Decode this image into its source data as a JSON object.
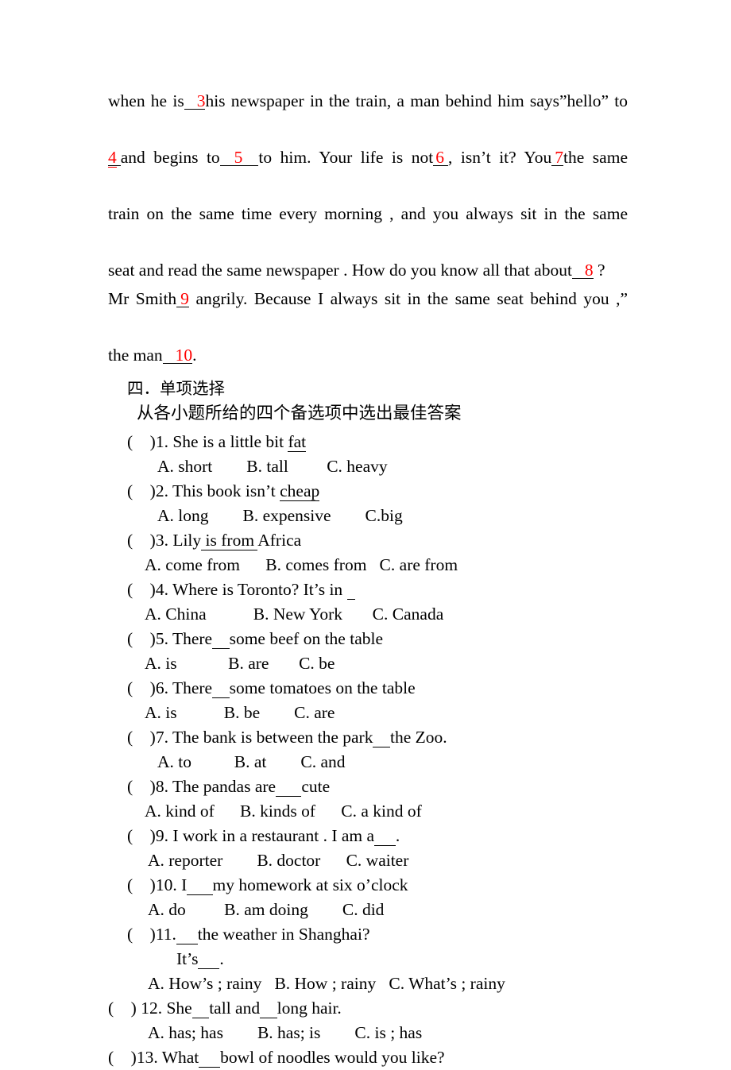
{
  "document": {
    "cloze_paragraph": {
      "line1_a": "when he is",
      "blank3": "3",
      "line1_b": "his newspaper in the train, a man behind him says”hello” to",
      "blank4": "4",
      "line2_a": "and begins to",
      "blank5": "5",
      "line2_b": "to him. Your life is not",
      "blank6": "6",
      "line2_c": ", isn’t it? You",
      "blank7": "7",
      "line2_d": "the same",
      "line3": "train on the same time every morning , and you always sit in the same",
      "line4_a": "seat and read the same newspaper . How do you know all that about",
      "blank8": "8",
      "line4_b": "?",
      "line5_a": "Mr Smith",
      "blank9": "9",
      "line5_b": "angrily. Because I always sit in the same seat behind you ,”",
      "line6_a": "the man",
      "blank10": "10",
      "line6_b": "."
    },
    "section_heading": "四．单项选择",
    "section_instruction": "从各小题所给的四个备选项中选出最佳答案",
    "questions": [
      {
        "marker": "(    )",
        "number": "1.",
        "stem_before": " She is a little bit ",
        "stem_underline": "fat",
        "stem_after": "",
        "options": "A. short        B. tall         C. heavy"
      },
      {
        "marker": "(    )",
        "number": "2.",
        "stem_before": " This book isn’t ",
        "stem_underline": "cheap",
        "stem_after": "",
        "options": "A. long        B. expensive        C.big"
      },
      {
        "marker": "(    )",
        "number": "3.",
        "stem_before": " Lily",
        "stem_underline": " is from ",
        "stem_after": "Africa",
        "options": "A. come from      B. comes from   C. are from"
      },
      {
        "marker": "(    )",
        "number": "4.",
        "stem_before": " Where is Toronto? It’s in ",
        "stem_underline": "  ",
        "stem_after": "",
        "options": "A. China           B. New York       C. Canada"
      },
      {
        "marker": "(    )",
        "number": "5.",
        "stem_before": " There",
        "stem_underline": "    ",
        "stem_after": "some beef on the table",
        "options": "A. is            B. are       C. be"
      },
      {
        "marker": "(    )",
        "number": "6.",
        "stem_before": " There",
        "stem_underline": "    ",
        "stem_after": "some tomatoes on the table",
        "options": "A. is           B. be        C. are"
      },
      {
        "marker": "(    )",
        "number": "7.",
        "stem_before": " The bank is between the park",
        "stem_underline": "    ",
        "stem_after": "the Zoo.",
        "options": "A. to          B. at        C. and"
      },
      {
        "marker": "(    )",
        "number": "8.",
        "stem_before": " The pandas are",
        "stem_underline": "      ",
        "stem_after": "cute",
        "options": "A. kind of      B. kinds of      C. a kind of"
      },
      {
        "marker": "(    )",
        "number": "9.",
        "stem_before": " I work in a restaurant . I am a",
        "stem_underline": "     ",
        "stem_after": ".",
        "options": "A. reporter        B. doctor      C. waiter"
      },
      {
        "marker": "(    )",
        "number": "10.",
        "stem_before": " I",
        "stem_underline": "      ",
        "stem_after": "my homework at six o’clock",
        "options": "A. do         B. am doing        C. did"
      },
      {
        "marker": "(    )",
        "number": "11.",
        "stem_before": "",
        "stem_underline": "     ",
        "stem_after": "the weather in Shanghai?",
        "sub_line_before": "It’s",
        "sub_line_underline": "     ",
        "sub_line_after": ".",
        "options": "A. How’s ; rainy   B. How ; rainy   C. What’s ; rainy"
      },
      {
        "marker": "(    ) ",
        "number": "12.",
        "stem_before": " She",
        "stem_underline": "    ",
        "stem_after": "tall and",
        "stem_underline2": "    ",
        "stem_after2": "long hair.",
        "options": "A. has; has        B. has; is        C. is ; has"
      },
      {
        "marker": "(    )",
        "number": "13.",
        "stem_before": " What",
        "stem_underline": "     ",
        "stem_after": "bowl of noodles would you like?",
        "options": ""
      }
    ]
  },
  "colors": {
    "blank_red": "#ff0000",
    "text_black": "#000000",
    "page_background": "#ffffff"
  }
}
